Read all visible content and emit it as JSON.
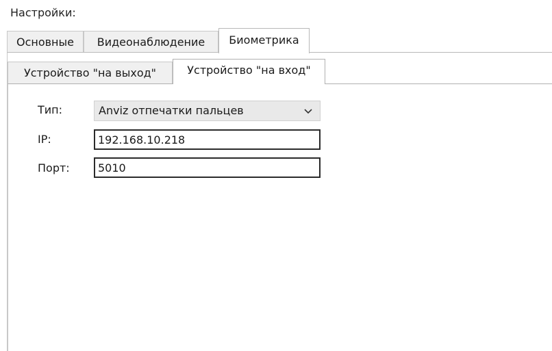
{
  "section_title": "Настройки:",
  "outer_tabs": [
    {
      "label": "Основные",
      "active": false
    },
    {
      "label": "Видеонаблюдение",
      "active": false
    },
    {
      "label": "Биометрика",
      "active": true
    }
  ],
  "inner_tabs": [
    {
      "label": "Устройство \"на выход\"",
      "active": false
    },
    {
      "label": "Устройство \"на вход\"",
      "active": true
    }
  ],
  "form": {
    "type_label": "Тип:",
    "type_value": "Anviz отпечатки пальцев",
    "type_icon": "chevron-down-icon",
    "ip_label": "IP:",
    "ip_value": "192.168.10.218",
    "port_label": "Порт:",
    "port_value": "5010"
  }
}
